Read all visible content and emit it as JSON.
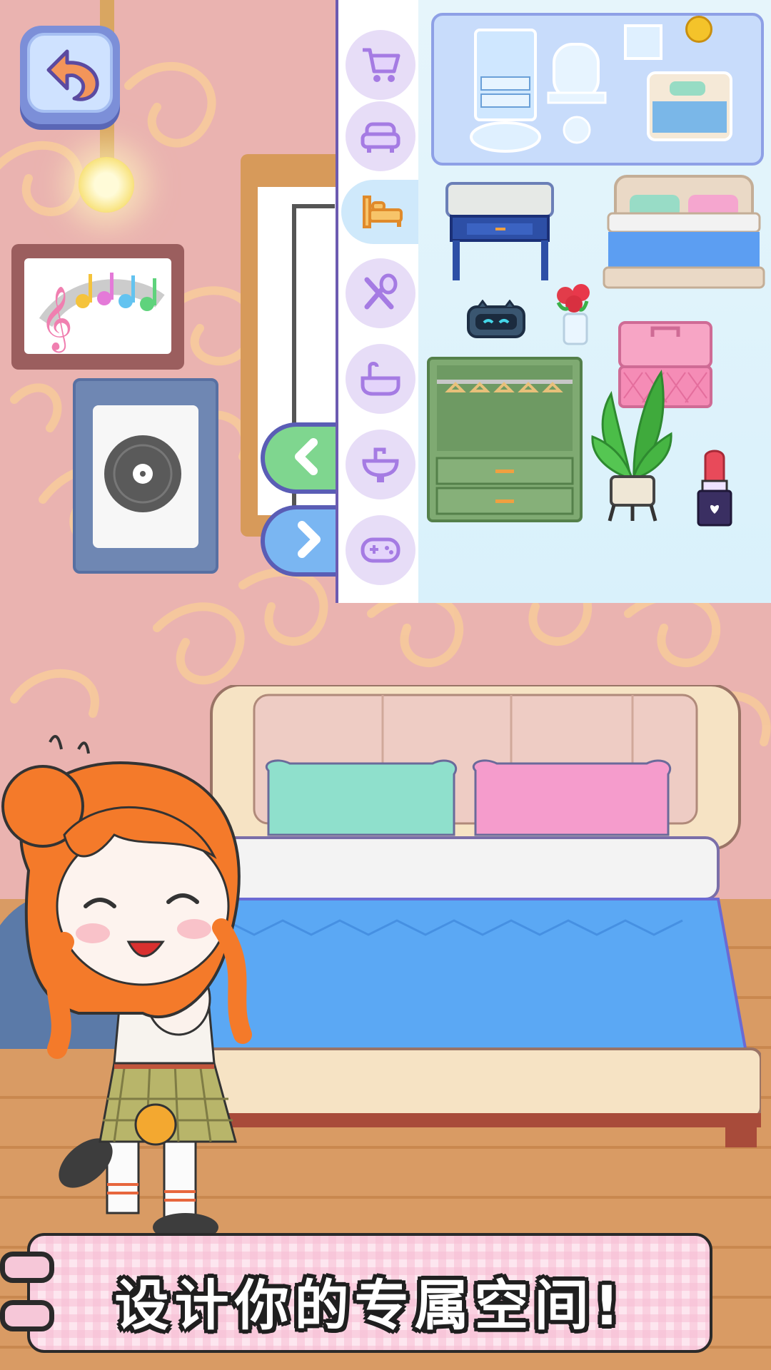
{
  "caption": {
    "text": "设计你的专属空间!"
  },
  "colors": {
    "wall": "#eab3b0",
    "wall_swirl": "#f7ca9c",
    "floor": "#d99b64",
    "panel_bg": "#e8f6fb",
    "tab_bg": "#e7ddf7",
    "tab_icon": "#b28ae8",
    "tab_selected_icon": "#f0a63a",
    "caption_outline": "#1f1f1f",
    "prev_button": "#7fd68f",
    "next_button": "#7ab6f2"
  },
  "toolbar": {
    "back_icon": "undo-arrow-icon",
    "prev_icon": "chevron-left-icon",
    "next_icon": "chevron-right-icon"
  },
  "category_tabs": [
    {
      "icon": "shopping-cart-icon",
      "selected": false
    },
    {
      "icon": "sofa-icon",
      "selected": false
    },
    {
      "icon": "bed-icon",
      "selected": true
    },
    {
      "icon": "utensils-icon",
      "selected": false
    },
    {
      "icon": "bathtub-icon",
      "selected": false
    },
    {
      "icon": "sink-icon",
      "selected": false
    },
    {
      "icon": "gamepad-icon",
      "selected": false
    }
  ],
  "catalog_items": [
    {
      "icon": "bedroom-set-icon"
    },
    {
      "icon": "coin-icon"
    },
    {
      "icon": "nightstand-icon"
    },
    {
      "icon": "double-bed-icon"
    },
    {
      "icon": "robot-clock-icon"
    },
    {
      "icon": "flower-vase-icon"
    },
    {
      "icon": "pink-case-icon"
    },
    {
      "icon": "wardrobe-icon"
    },
    {
      "icon": "potted-plant-icon"
    },
    {
      "icon": "lipstick-icon"
    }
  ],
  "room": {
    "decor": [
      "wall-lamp-icon",
      "music-notes-painting-icon",
      "vinyl-record-painting-icon",
      "door-icon",
      "bed-icon",
      "character-girl-icon"
    ]
  }
}
